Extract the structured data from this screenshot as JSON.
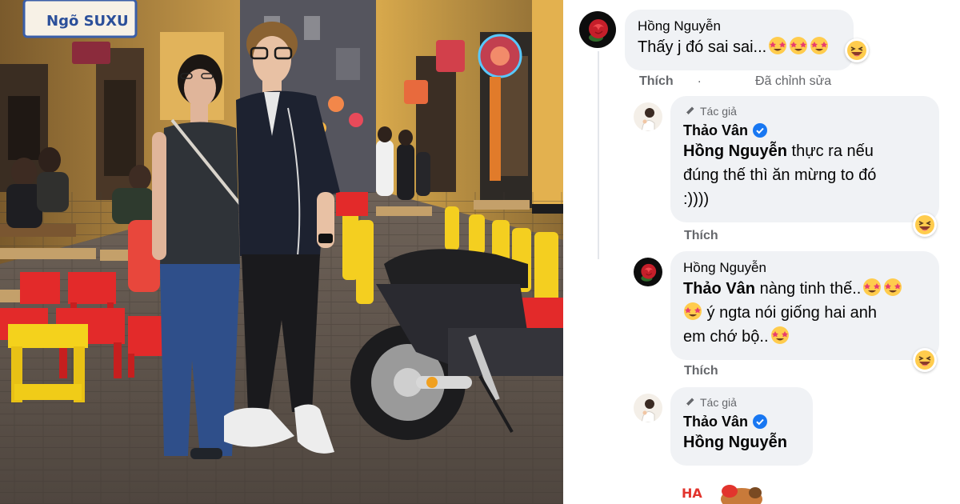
{
  "photo": {
    "sign_main": "Ngõ SUXU",
    "scene": "street-photo"
  },
  "comments": [
    {
      "author": "Hồng Nguyễn",
      "text": "Thấy j đó sai sai...",
      "like_label": "Thích",
      "separator": ".",
      "edited_label": "Đã chỉnh sửa"
    },
    {
      "badge": "Tác giả",
      "author": "Thảo Vân",
      "mention": "Hồng Nguyễn",
      "text_line1": " thực ra nếu",
      "text_line2": "đúng thế thì ăn mừng to đó",
      "text_line3": ":))))",
      "like_label": "Thích"
    },
    {
      "author": "Hồng Nguyễn",
      "mention": "Thảo Vân",
      "text_line1": " nàng tinh thế..",
      "text_line2": " ý ngta nói giống hai anh",
      "text_line3": "em chớ bộ..",
      "like_label": "Thích"
    },
    {
      "badge": "Tác giả",
      "author": "Thảo Vân",
      "mention": "Hồng Nguyễn"
    }
  ],
  "colors": {
    "bubble": "#f0f2f5",
    "muted": "#65676b",
    "verified": "#1877f2",
    "emoji_face": "#ffcc4d"
  },
  "icons": [
    "rose-avatar",
    "author-avatar",
    "star-struck-emoji",
    "laughing-emoji",
    "pen-icon",
    "verified-icon",
    "sticker"
  ]
}
